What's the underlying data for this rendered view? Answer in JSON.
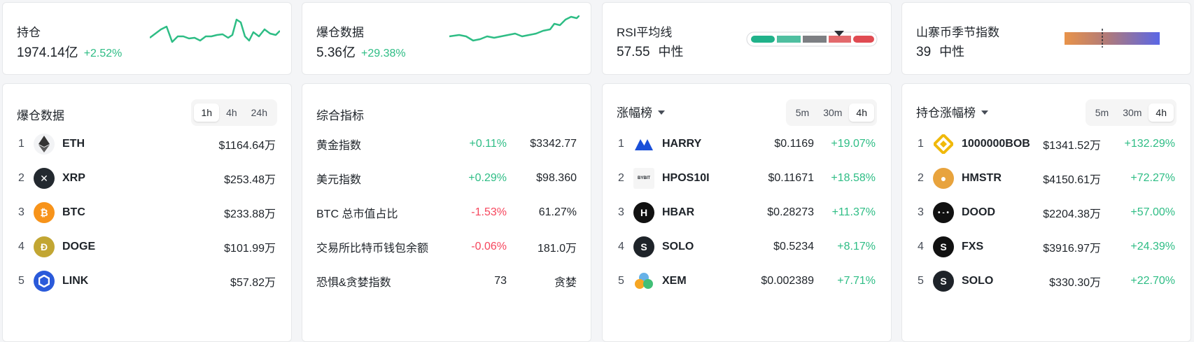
{
  "stats": {
    "open_interest": {
      "title": "持仓",
      "value": "1974.14亿",
      "change": "+2.52%"
    },
    "liquidation": {
      "title": "爆仓数据",
      "value": "5.36亿",
      "change": "+29.38%"
    },
    "rsi": {
      "title": "RSI平均线",
      "value": "57.55",
      "status": "中性"
    },
    "altseason": {
      "title": "山寨币季节指数",
      "value": "39",
      "status": "中性"
    }
  },
  "colors": {
    "up": "#2ebd85",
    "down": "#f6465d",
    "rsi_segments": [
      "#20b28a",
      "#4fbfa0",
      "#7d7f83",
      "#e36a6d",
      "#e04b52"
    ],
    "altseason_gradient": [
      "#e8934a",
      "#5a67e6"
    ]
  },
  "liquidation_panel": {
    "title": "爆仓数据",
    "timeframes": [
      "1h",
      "4h",
      "24h"
    ],
    "active_timeframe": "1h",
    "rows": [
      {
        "rank": "1",
        "symbol": "ETH",
        "icon": "eth-icon",
        "amount": "$1164.64万"
      },
      {
        "rank": "2",
        "symbol": "XRP",
        "icon": "xrp-icon",
        "amount": "$253.48万"
      },
      {
        "rank": "3",
        "symbol": "BTC",
        "icon": "btc-icon",
        "amount": "$233.88万"
      },
      {
        "rank": "4",
        "symbol": "DOGE",
        "icon": "doge-icon",
        "amount": "$101.99万"
      },
      {
        "rank": "5",
        "symbol": "LINK",
        "icon": "link-icon",
        "amount": "$57.82万"
      }
    ]
  },
  "composite_panel": {
    "title": "综合指标",
    "rows": [
      {
        "name": "黄金指数",
        "change": "+0.11%",
        "direction": "up",
        "value": "$3342.77"
      },
      {
        "name": "美元指数",
        "change": "+0.29%",
        "direction": "up",
        "value": "$98.360"
      },
      {
        "name": "BTC 总市值占比",
        "change": "-1.53%",
        "direction": "down",
        "value": "61.27%"
      },
      {
        "name": "交易所比特币钱包余额",
        "change": "-0.06%",
        "direction": "down",
        "value": "181.0万"
      },
      {
        "name": "恐惧&贪婪指数",
        "change": "73",
        "direction": "none",
        "value": "贪婪"
      }
    ]
  },
  "gainers_panel": {
    "title": "涨幅榜",
    "timeframes": [
      "5m",
      "30m",
      "4h"
    ],
    "active_timeframe": "4h",
    "rows": [
      {
        "rank": "1",
        "symbol": "HARRY",
        "icon": "harry-icon",
        "price": "$0.1169",
        "change": "+19.07%"
      },
      {
        "rank": "2",
        "symbol": "HPOS10I",
        "icon": "hpos10i-icon",
        "price": "$0.11671",
        "change": "+18.58%"
      },
      {
        "rank": "3",
        "symbol": "HBAR",
        "icon": "hbar-icon",
        "price": "$0.28273",
        "change": "+11.37%"
      },
      {
        "rank": "4",
        "symbol": "SOLO",
        "icon": "solo-icon",
        "price": "$0.5234",
        "change": "+8.17%"
      },
      {
        "rank": "5",
        "symbol": "XEM",
        "icon": "xem-icon",
        "price": "$0.002389",
        "change": "+7.71%"
      }
    ]
  },
  "oi_gainers_panel": {
    "title": "持仓涨幅榜",
    "timeframes": [
      "5m",
      "30m",
      "4h"
    ],
    "active_timeframe": "4h",
    "rows": [
      {
        "rank": "1",
        "symbol": "1000000BOB",
        "icon": "bob-icon",
        "amount": "$1341.52万",
        "change": "+132.29%"
      },
      {
        "rank": "2",
        "symbol": "HMSTR",
        "icon": "hmstr-icon",
        "amount": "$4150.61万",
        "change": "+72.27%"
      },
      {
        "rank": "3",
        "symbol": "DOOD",
        "icon": "dood-icon",
        "amount": "$2204.38万",
        "change": "+57.00%"
      },
      {
        "rank": "4",
        "symbol": "FXS",
        "icon": "fxs-icon",
        "amount": "$3916.97万",
        "change": "+24.39%"
      },
      {
        "rank": "5",
        "symbol": "SOLO",
        "icon": "solo-icon",
        "amount": "$330.30万",
        "change": "+22.70%"
      }
    ]
  }
}
